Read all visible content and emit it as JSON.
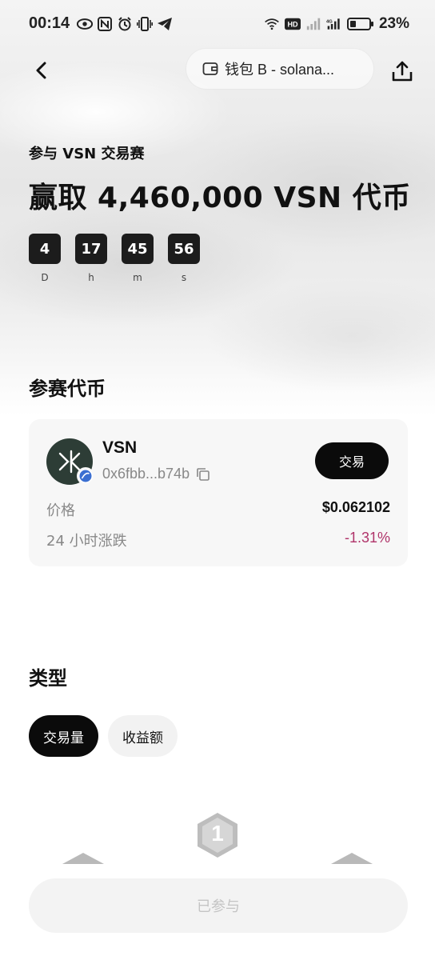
{
  "status_bar": {
    "time": "00:14",
    "battery": "23%",
    "left_icons": [
      "eye-icon",
      "nfc-icon",
      "alarm-icon",
      "vibrate-icon",
      "telegram-icon"
    ],
    "right_icons": [
      "wifi-icon",
      "hd-icon",
      "signal-icon",
      "4g-signal-icon",
      "battery-icon"
    ]
  },
  "header": {
    "back_icon": "chevron-left-icon",
    "wallet_icon": "wallet-icon",
    "wallet_label": "钱包 B - solana...",
    "share_icon": "share-icon"
  },
  "event": {
    "subtitle": "参与 VSN 交易赛",
    "title": "赢取 4,460,000 VSN 代币"
  },
  "countdown": [
    {
      "value": "4",
      "unit": "D"
    },
    {
      "value": "17",
      "unit": "h"
    },
    {
      "value": "45",
      "unit": "m"
    },
    {
      "value": "56",
      "unit": "s"
    }
  ],
  "tokens_section": {
    "title": "参赛代币"
  },
  "token_card": {
    "name": "VSN",
    "address": "0x6fbb...b74b",
    "trade_label": "交易",
    "price_label": "价格",
    "price_value": "$0.062102",
    "change_label": "24 小时涨跌",
    "change_value": "-1.31%",
    "colors": {
      "negative": "#b0346a",
      "logo_bg": "#2d3d36"
    }
  },
  "type_section": {
    "title": "类型",
    "tabs": [
      {
        "label": "交易量",
        "active": true
      },
      {
        "label": "收益额",
        "active": false
      }
    ]
  },
  "podium": {
    "rank_first": "1"
  },
  "footer": {
    "join_label": "已参与"
  }
}
